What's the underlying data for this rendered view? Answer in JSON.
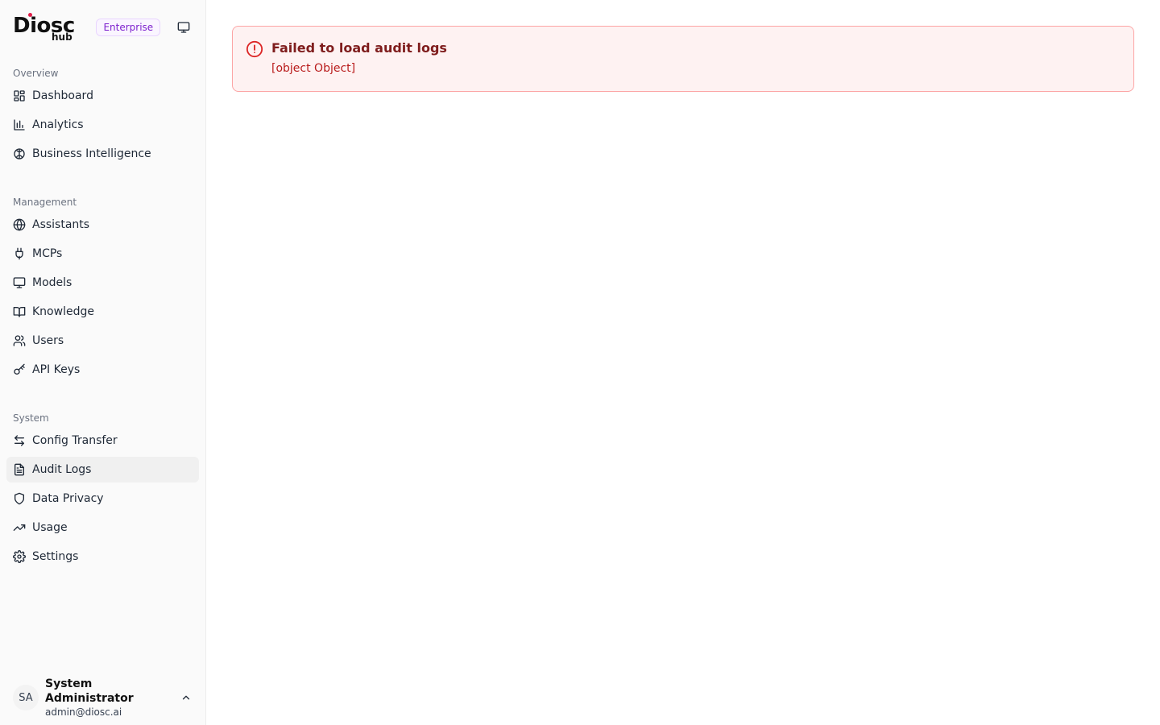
{
  "brand": {
    "logo_text": "Diosc",
    "logo_sub": "hub",
    "edition_badge": "Enterprise",
    "display_icon": "monitor-icon"
  },
  "sidebar": {
    "sections": [
      {
        "label": "Overview",
        "items": [
          {
            "label": "Dashboard",
            "icon": "layout-grid-icon"
          },
          {
            "label": "Analytics",
            "icon": "bar-chart-icon"
          },
          {
            "label": "Business Intelligence",
            "icon": "brain-icon"
          }
        ]
      },
      {
        "label": "Management",
        "items": [
          {
            "label": "Assistants",
            "icon": "globe-icon"
          },
          {
            "label": "MCPs",
            "icon": "plug-icon"
          },
          {
            "label": "Models",
            "icon": "monitor-icon"
          },
          {
            "label": "Knowledge",
            "icon": "book-icon"
          },
          {
            "label": "Users",
            "icon": "users-icon"
          },
          {
            "label": "API Keys",
            "icon": "key-icon"
          }
        ]
      },
      {
        "label": "System",
        "items": [
          {
            "label": "Config Transfer",
            "icon": "arrows-left-right-icon"
          },
          {
            "label": "Audit Logs",
            "icon": "file-text-icon",
            "active": true
          },
          {
            "label": "Data Privacy",
            "icon": "shield-icon"
          },
          {
            "label": "Usage",
            "icon": "trending-up-icon"
          },
          {
            "label": "Settings",
            "icon": "gear-icon"
          }
        ]
      }
    ]
  },
  "user": {
    "initials": "SA",
    "name": "System Administrator",
    "email": "admin@diosc.ai"
  },
  "alert": {
    "title": "Failed to load audit logs",
    "message": "[object Object]",
    "icon": "alert-circle-icon"
  },
  "colors": {
    "accent_purple": "#7e22ce",
    "error_border": "#fca5a5",
    "error_bg": "#fef2f2",
    "error_text": "#b91c1c",
    "active_item_bg": "#f0f0f0"
  }
}
